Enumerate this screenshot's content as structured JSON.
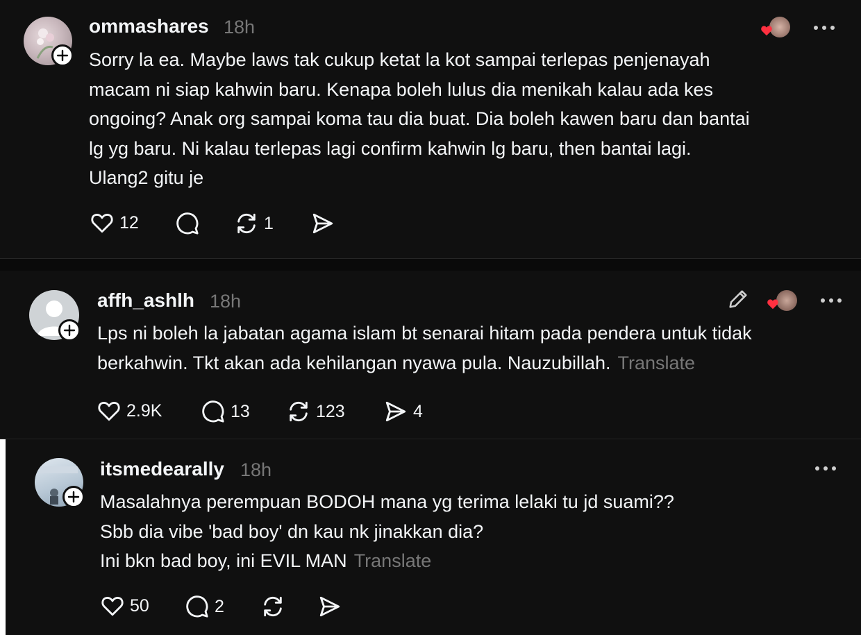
{
  "posts": [
    {
      "username": "ommashares",
      "time": "18h",
      "lines": [
        "Sorry la ea. Maybe laws tak cukup ketat la kot sampai terlepas penjenayah",
        "macam ni siap kahwin baru. Kenapa boleh lulus dia menikah kalau ada kes",
        "ongoing? Anak org sampai koma tau dia buat. Dia boleh kawen baru dan bantai",
        "lg yg baru. Ni kalau terlepas lagi confirm kahwin lg baru, then bantai lagi.",
        "Ulang2 gitu je"
      ],
      "translate": "",
      "likes": "12",
      "replies": "",
      "reposts": "1",
      "shares": ""
    },
    {
      "username": "affh_ashlh",
      "time": "18h",
      "lines": [
        "Lps ni boleh la jabatan agama islam bt senarai hitam pada pendera untuk tidak",
        "berkahwin. Tkt akan ada kehilangan nyawa pula. Nauzubillah."
      ],
      "translate": "Translate",
      "likes": "2.9K",
      "replies": "13",
      "reposts": "123",
      "shares": "4"
    },
    {
      "username": "itsmedearally",
      "time": "18h",
      "lines": [
        "Masalahnya perempuan BODOH mana yg terima lelaki tu jd suami??",
        "Sbb dia vibe 'bad boy' dn kau nk jinakkan dia?",
        "Ini bkn bad boy, ini EVIL MAN"
      ],
      "translate": "Translate",
      "likes": "50",
      "replies": "2",
      "reposts": "",
      "shares": ""
    }
  ],
  "icons": {
    "like": "heart-outline-icon",
    "reply": "speech-bubble-icon",
    "repost": "repost-arrows-icon",
    "share": "paper-plane-icon",
    "more": "ellipsis-icon",
    "follow": "plus-icon",
    "edit": "pencil-icon"
  },
  "colors": {
    "background": "#101010",
    "text": "#f3f5f7",
    "secondary": "#777777",
    "heart_badge": "#ff3040"
  }
}
